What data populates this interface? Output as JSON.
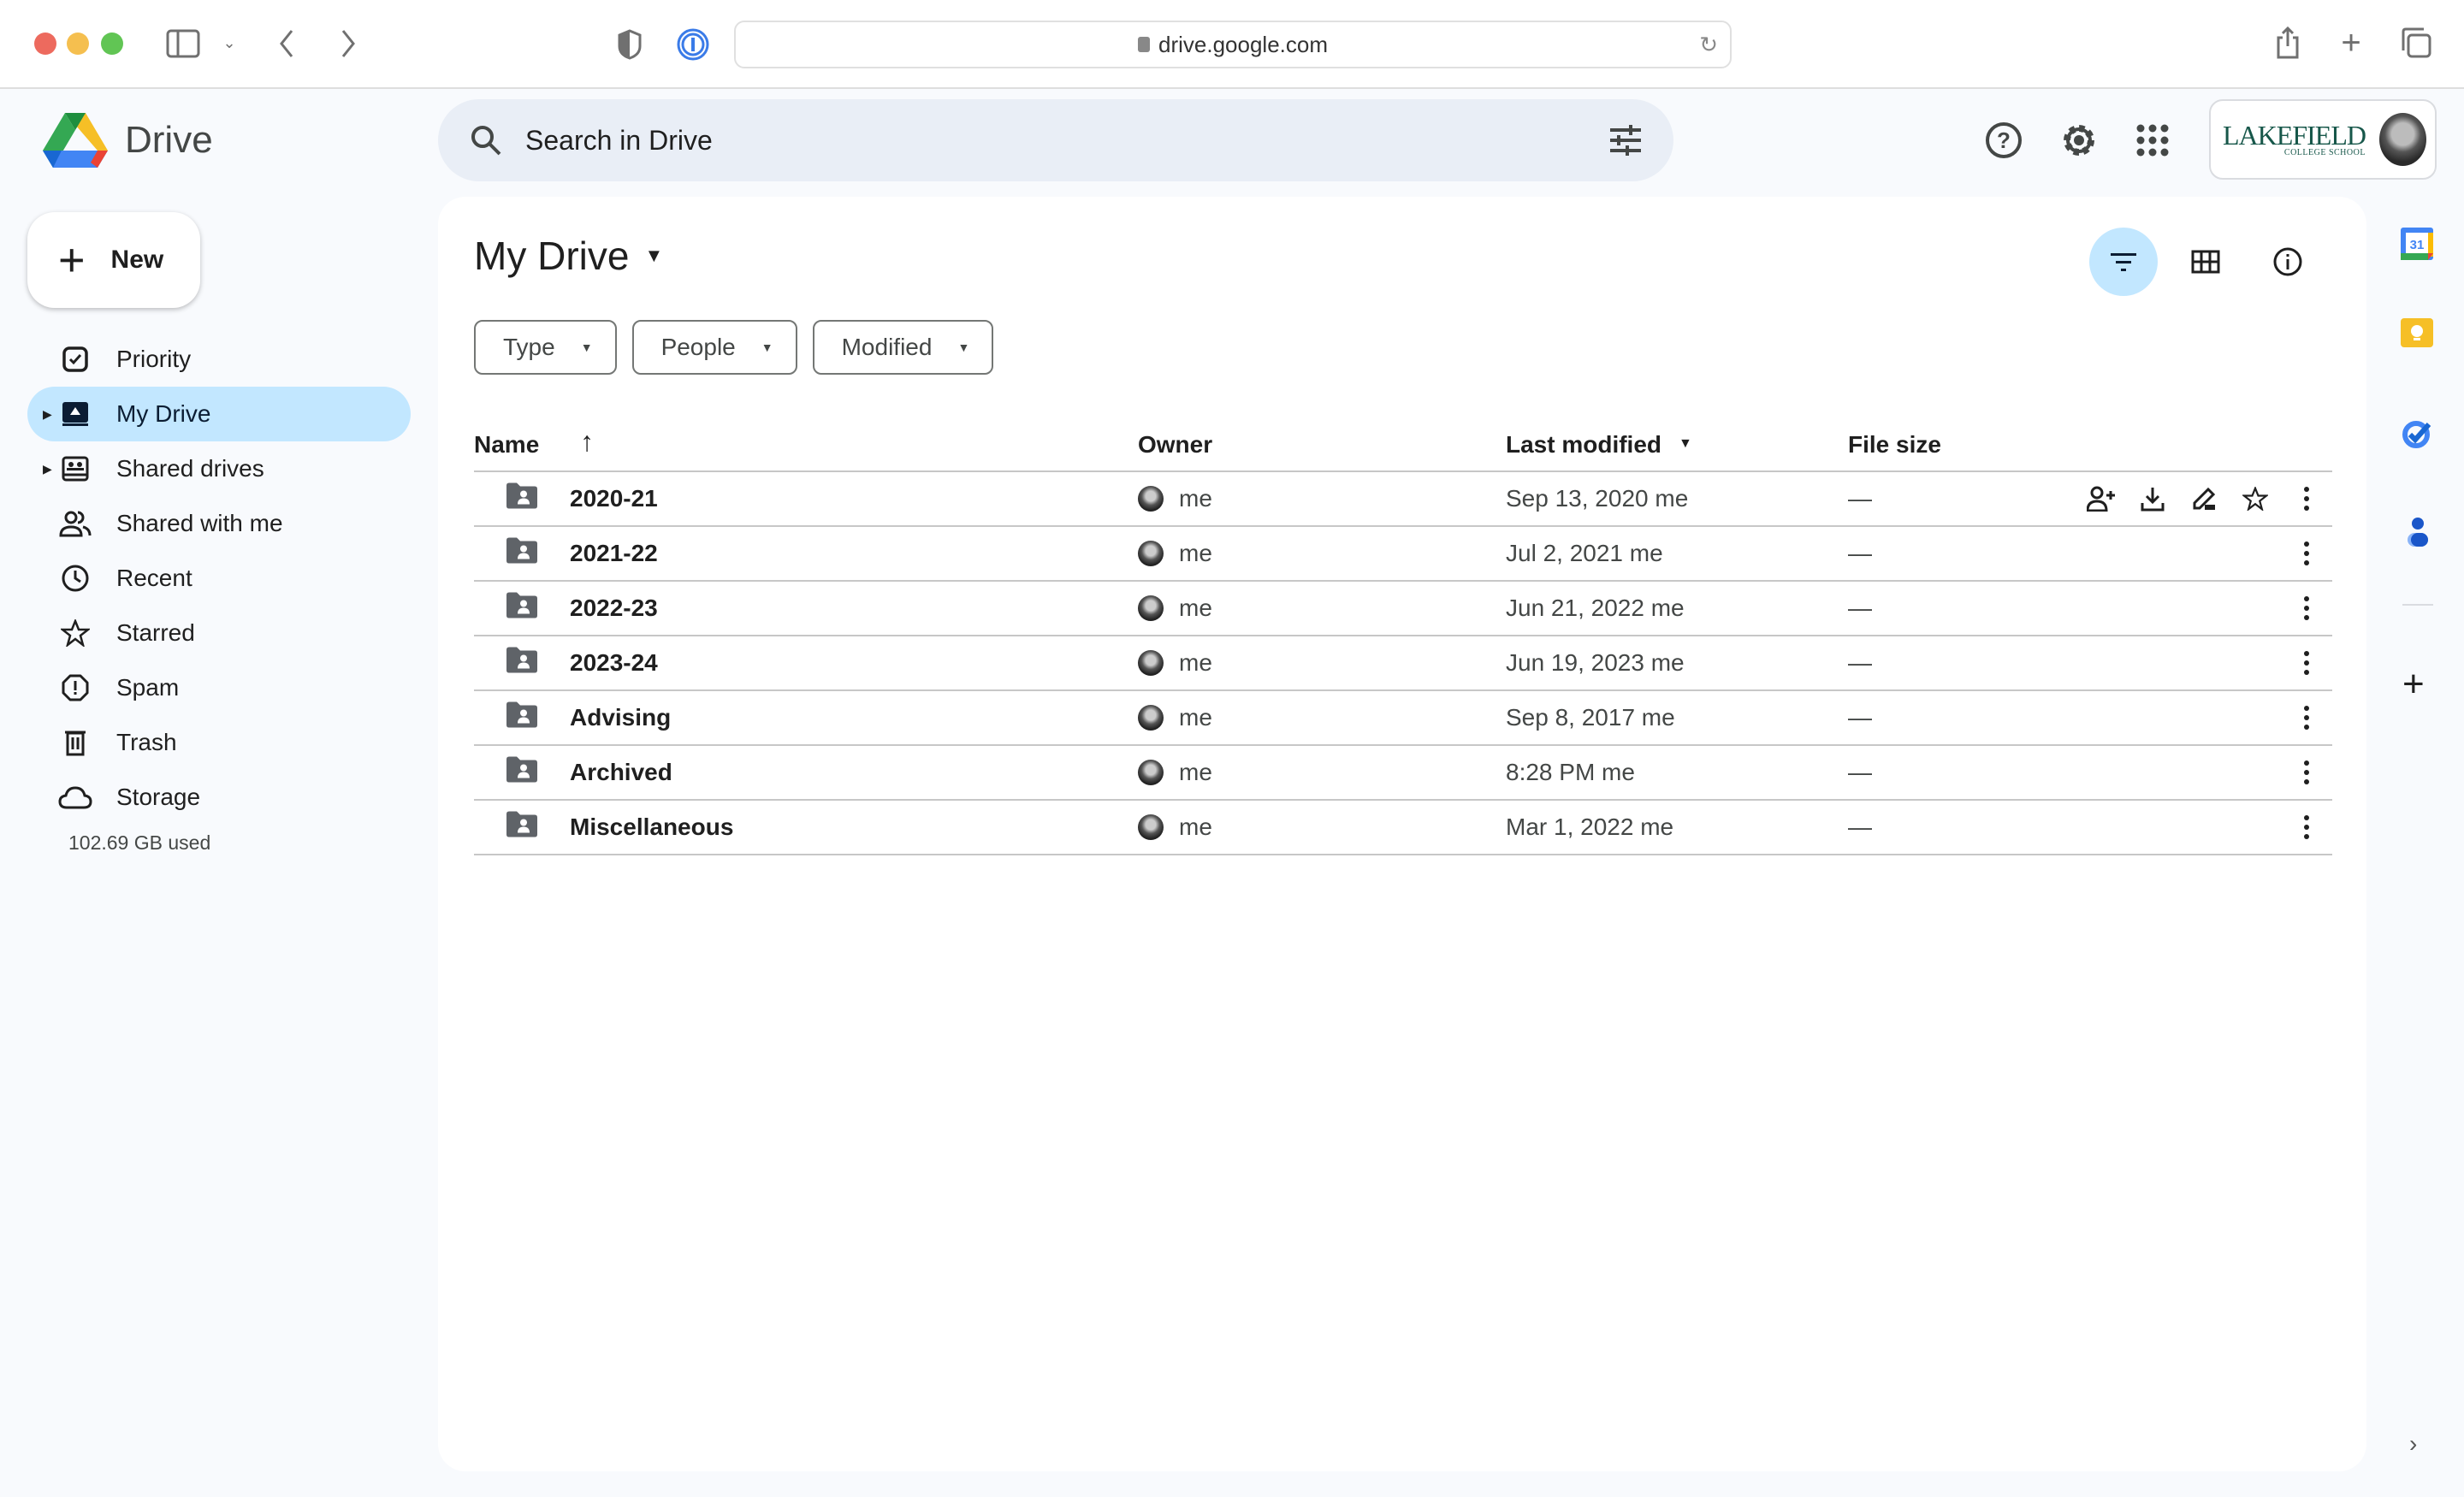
{
  "browser": {
    "url": "drive.google.com"
  },
  "app": {
    "name": "Drive",
    "search_placeholder": "Search in Drive",
    "account_org_line1": "LAKEFIELD",
    "account_org_line2": "COLLEGE SCHOOL"
  },
  "sidebar": {
    "new_label": "New",
    "items": [
      {
        "label": "Priority",
        "icon": "priority-icon",
        "active": false,
        "expandable": false
      },
      {
        "label": "My Drive",
        "icon": "my-drive-icon",
        "active": true,
        "expandable": true
      },
      {
        "label": "Shared drives",
        "icon": "shared-drives-icon",
        "active": false,
        "expandable": true
      },
      {
        "label": "Shared with me",
        "icon": "shared-with-me-icon",
        "active": false,
        "expandable": false
      },
      {
        "label": "Recent",
        "icon": "clock-icon",
        "active": false,
        "expandable": false
      },
      {
        "label": "Starred",
        "icon": "star-icon",
        "active": false,
        "expandable": false
      },
      {
        "label": "Spam",
        "icon": "spam-icon",
        "active": false,
        "expandable": false
      },
      {
        "label": "Trash",
        "icon": "trash-icon",
        "active": false,
        "expandable": false
      },
      {
        "label": "Storage",
        "icon": "cloud-icon",
        "active": false,
        "expandable": false
      }
    ],
    "storage_used": "102.69 GB used"
  },
  "main": {
    "title": "My Drive",
    "filters": [
      {
        "label": "Type"
      },
      {
        "label": "People"
      },
      {
        "label": "Modified"
      }
    ],
    "columns": {
      "name": "Name",
      "owner": "Owner",
      "last_modified": "Last modified",
      "file_size": "File size"
    },
    "rows": [
      {
        "name": "2020-21",
        "owner": "me",
        "modified": "Sep 13, 2020 me",
        "size": "—",
        "hovered": true
      },
      {
        "name": "2021-22",
        "owner": "me",
        "modified": "Jul 2, 2021 me",
        "size": "—",
        "hovered": false
      },
      {
        "name": "2022-23",
        "owner": "me",
        "modified": "Jun 21, 2022 me",
        "size": "—",
        "hovered": false
      },
      {
        "name": "2023-24",
        "owner": "me",
        "modified": "Jun 19, 2023 me",
        "size": "—",
        "hovered": false
      },
      {
        "name": "Advising",
        "owner": "me",
        "modified": "Sep 8, 2017 me",
        "size": "—",
        "hovered": false
      },
      {
        "name": "Archived",
        "owner": "me",
        "modified": "8:28 PM me",
        "size": "—",
        "hovered": false
      },
      {
        "name": "Miscellaneous",
        "owner": "me",
        "modified": "Mar 1, 2022 me",
        "size": "—",
        "hovered": false
      }
    ]
  },
  "colors": {
    "active_nav": "#c2e7ff",
    "search_bg": "#e9eef6",
    "app_bg": "#f8fafd"
  }
}
